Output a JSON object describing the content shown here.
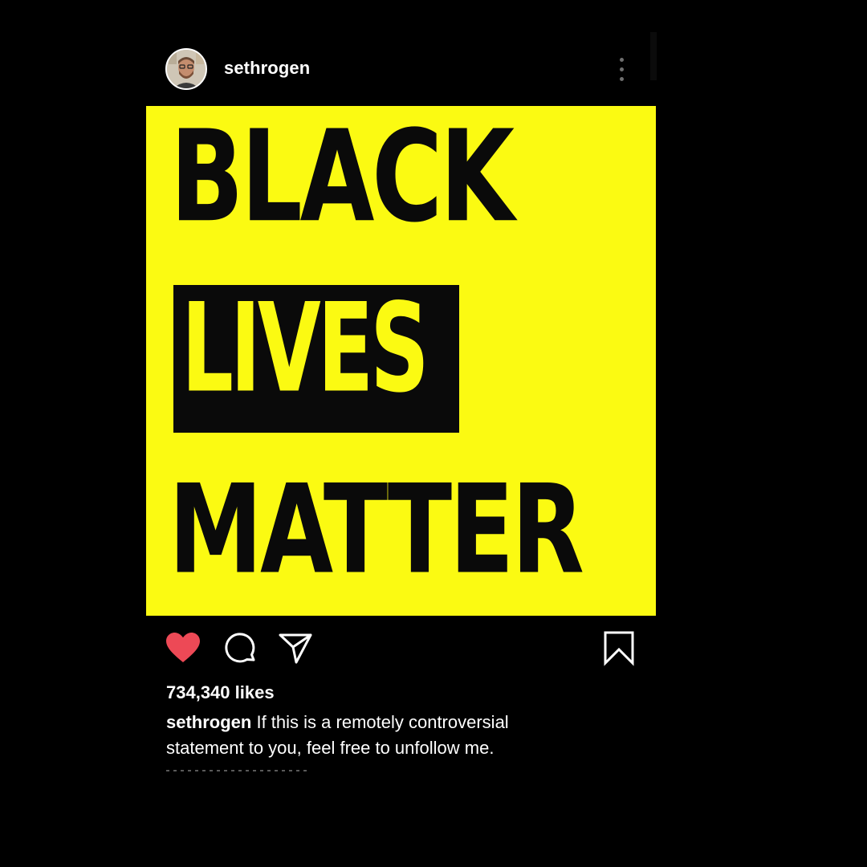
{
  "post": {
    "username": "sethrogen",
    "avatar_icon": "profile-photo",
    "more_icon": "more-vertical-icon"
  },
  "image": {
    "background_color": "#fbfa12",
    "text_color": "#0a0a0a",
    "line1": "BLACK",
    "line2": "LIVES",
    "line3": "MATTER"
  },
  "actions": {
    "like_icon": "heart-filled-icon",
    "like_color": "#ed4956",
    "comment_icon": "comment-icon",
    "share_icon": "send-icon",
    "save_icon": "bookmark-icon"
  },
  "likes_text": "734,340 likes",
  "caption": {
    "username": "sethrogen",
    "text": " If this is a remotely controversial statement to you, feel free to unfollow me."
  }
}
